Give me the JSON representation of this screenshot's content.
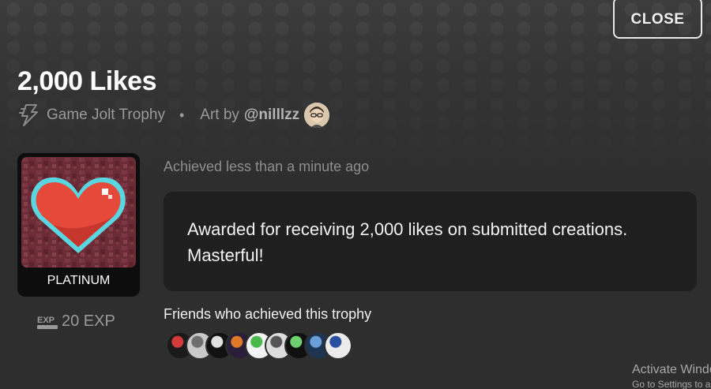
{
  "header": {
    "close_label": "CLOSE"
  },
  "trophy": {
    "title": "2,000 Likes",
    "type_label": "Game Jolt Trophy",
    "separator": "•",
    "art_by_prefix": "Art by",
    "artist_handle": "@nilllzz",
    "rarity": "PLATINUM",
    "exp": "20 EXP",
    "achieved_text": "Achieved less than a minute ago",
    "description": "Awarded for receiving 2,000 likes on submitted creations. Masterful!"
  },
  "friends": {
    "title": "Friends who achieved this trophy",
    "avatars": [
      {
        "color": "#1a1a1a",
        "accent": "#d23b3b"
      },
      {
        "color": "#c9c9c9",
        "accent": "#6f6f6f"
      },
      {
        "color": "#111111",
        "accent": "#e0e0e0"
      },
      {
        "color": "#2a1f3a",
        "accent": "#e07a2a"
      },
      {
        "color": "#f4f4f4",
        "accent": "#4ab84a"
      },
      {
        "color": "#dcdcdc",
        "accent": "#555555"
      },
      {
        "color": "#101010",
        "accent": "#6fd06f"
      },
      {
        "color": "#1d3550",
        "accent": "#6aa0d8"
      },
      {
        "color": "#ececec",
        "accent": "#2a4fa0"
      }
    ]
  },
  "watermark": {
    "line1": "Activate Windows",
    "line2": "Go to Settings to activate Windows."
  },
  "colors": {
    "background": "#2e2e2e",
    "box": "#1f1f1f",
    "muted_text": "#9a9a9a",
    "heart": "#e4493a",
    "heart_outline": "#5ad6e0",
    "art_background": "#6b2c36"
  }
}
